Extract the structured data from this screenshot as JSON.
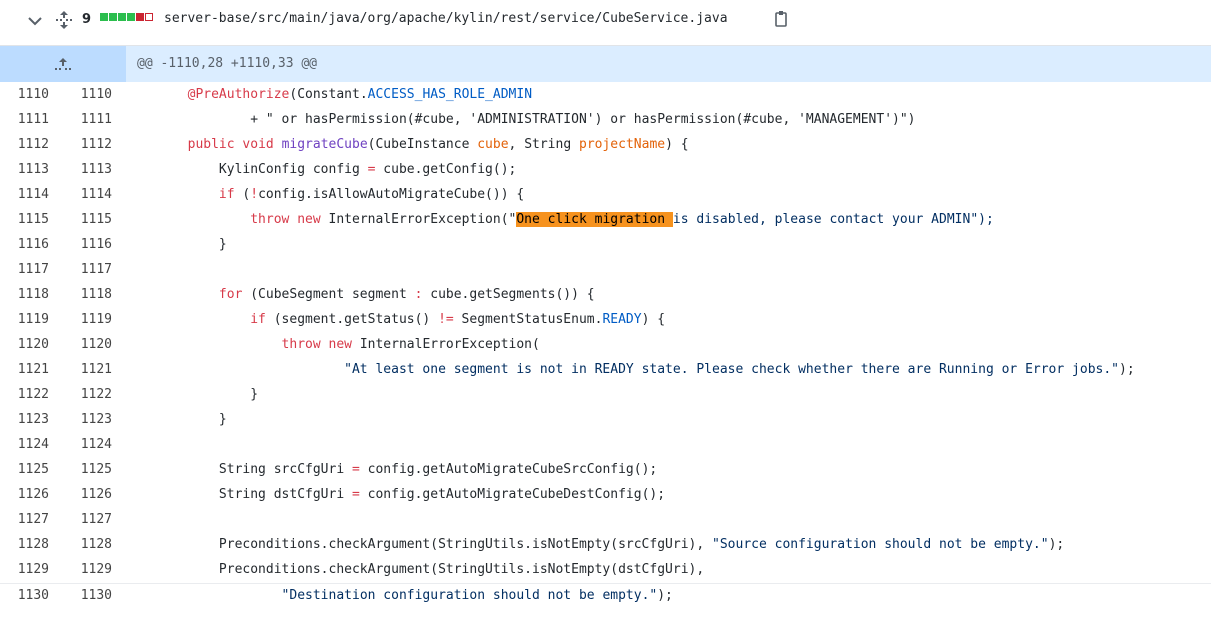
{
  "file": {
    "changes": "9",
    "path": "server-base/src/main/java/org/apache/kylin/rest/service/CubeService.java",
    "diffstat_colors": [
      "#2cbe4e",
      "#2cbe4e",
      "#2cbe4e",
      "#cb2431",
      "#ffffff"
    ]
  },
  "hunk": {
    "header": "@@ -1110,28 +1110,33 @@"
  },
  "lines": [
    {
      "old": "1110",
      "new": "1110",
      "t1": "@PreAuthorize",
      "t2": "(Constant.",
      "t3": "ACCESS_HAS_ROLE_ADMIN"
    },
    {
      "old": "1111",
      "new": "1111",
      "t1": "+ \" or hasPermission(#cube, 'ADMINISTRATION') or hasPermission(#cube, 'MANAGEMENT')\")"
    },
    {
      "old": "1112",
      "new": "1112",
      "t1": "public",
      "t2": "void",
      "t3": "migrateCube",
      "t4": "(CubeInstance ",
      "t5": "cube",
      ",t6": "",
      "t7": ", String ",
      "t8": "projectName",
      "t9": ") {"
    },
    {
      "old": "1113",
      "new": "1113",
      "t1": "KylinConfig config ",
      "t2": "=",
      "t3": " cube.getConfig();"
    },
    {
      "old": "1114",
      "new": "1114",
      "t1": "if",
      "t2": " (",
      "t3": "!",
      "t4": "config.isAllowAutoMigrateCube()) {"
    },
    {
      "old": "1115",
      "new": "1115",
      "t1": "throw",
      "t2": "new",
      "t3": " InternalErrorException(\"",
      "t4": "One click migration ",
      "t5": "is disabled, please contact your ADMIN\");"
    },
    {
      "old": "1116",
      "new": "1116",
      "t1": "}"
    },
    {
      "old": "1117",
      "new": "1117"
    },
    {
      "old": "1118",
      "new": "1118",
      "t1": "for",
      "t2": " (CubeSegment segment ",
      "t3": ":",
      "t4": " cube.getSegments()) {"
    },
    {
      "old": "1119",
      "new": "1119",
      "t1": "if",
      "t2": " (segment.getStatus() ",
      "t3": "!=",
      "t4": " SegmentStatusEnum.",
      "t5": "READY",
      "t6": ") {"
    },
    {
      "old": "1120",
      "new": "1120",
      "t1": "throw",
      "t2": "new",
      "t3": " InternalErrorException("
    },
    {
      "old": "1121",
      "new": "1121",
      "t1": "\"At least one segment is not in READY state. Please check whether there are Running or Error jobs.\"",
      "t2": ");"
    },
    {
      "old": "1122",
      "new": "1122",
      "t1": "}"
    },
    {
      "old": "1123",
      "new": "1123",
      "t1": "}"
    },
    {
      "old": "1124",
      "new": "1124"
    },
    {
      "old": "1125",
      "new": "1125",
      "t1": "String srcCfgUri ",
      "t2": "=",
      "t3": " config.getAutoMigrateCubeSrcConfig();"
    },
    {
      "old": "1126",
      "new": "1126",
      "t1": "String dstCfgUri ",
      "t2": "=",
      "t3": " config.getAutoMigrateCubeDestConfig();"
    },
    {
      "old": "1127",
      "new": "1127"
    },
    {
      "old": "1128",
      "new": "1128",
      "t1": "Preconditions.checkArgument(StringUtils.isNotEmpty(srcCfgUri), ",
      "t2": "\"Source configuration should not be empty.\"",
      "t3": ");"
    },
    {
      "old": "1129",
      "new": "1129",
      "t1": "Preconditions.checkArgument(StringUtils.isNotEmpty(dstCfgUri),"
    },
    {
      "old": "1130",
      "new": "1130",
      "t1": "\"Destination configuration should not be empty.\"",
      "t2": ");"
    }
  ]
}
